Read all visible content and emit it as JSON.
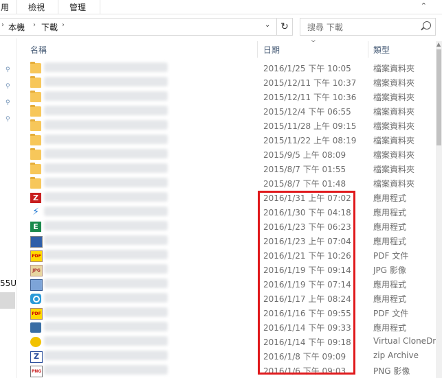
{
  "ribbon": {
    "tabs": [
      "用",
      "檢視",
      "管理"
    ]
  },
  "address": {
    "crumbs": [
      "本機",
      "下載"
    ]
  },
  "search": {
    "placeholder": "搜尋 下載"
  },
  "nav": {
    "fragment_label": "55U"
  },
  "columns": {
    "name": "名稱",
    "date": "日期",
    "type": "類型"
  },
  "rows": [
    {
      "icon": "folder-icon",
      "date": "2016/1/25 下午 10:05",
      "type": "檔案資料夾"
    },
    {
      "icon": "folder-icon",
      "date": "2015/12/11 下午 10:37",
      "type": "檔案資料夾"
    },
    {
      "icon": "folder-icon",
      "date": "2015/12/11 下午 10:36",
      "type": "檔案資料夾"
    },
    {
      "icon": "folder-icon",
      "date": "2015/12/4 下午 06:55",
      "type": "檔案資料夾"
    },
    {
      "icon": "folder-icon",
      "date": "2015/11/28 上午 09:15",
      "type": "檔案資料夾"
    },
    {
      "icon": "folder-icon",
      "date": "2015/11/22 上午 08:19",
      "type": "檔案資料夾"
    },
    {
      "icon": "folder-icon",
      "date": "2015/9/5 上午 08:09",
      "type": "檔案資料夾"
    },
    {
      "icon": "folder-icon",
      "date": "2015/8/7 下午 01:55",
      "type": "檔案資料夾"
    },
    {
      "icon": "folder-icon",
      "date": "2015/8/7 下午 01:48",
      "type": "檔案資料夾"
    },
    {
      "icon": "filezilla-icon",
      "date": "2016/1/31 上午 07:02",
      "type": "應用程式"
    },
    {
      "icon": "bolt-icon",
      "date": "2016/1/30 下午 04:18",
      "type": "應用程式"
    },
    {
      "icon": "e-app-icon",
      "date": "2016/1/23 下午 06:23",
      "type": "應用程式"
    },
    {
      "icon": "installer-icon",
      "date": "2016/1/23 上午 07:04",
      "type": "應用程式"
    },
    {
      "icon": "pdf-icon",
      "date": "2016/1/21 下午 10:26",
      "type": "PDF 文件"
    },
    {
      "icon": "jpg-icon",
      "date": "2016/1/19 下午 09:14",
      "type": "JPG 影像"
    },
    {
      "icon": "window-app-icon",
      "date": "2016/1/19 下午 07:14",
      "type": "應用程式"
    },
    {
      "icon": "ring-app-icon",
      "date": "2016/1/17 上午 08:24",
      "type": "應用程式"
    },
    {
      "icon": "pdf-icon",
      "date": "2016/1/16 下午 09:55",
      "type": "PDF 文件"
    },
    {
      "icon": "gear-app-icon",
      "date": "2016/1/14 下午 09:33",
      "type": "應用程式"
    },
    {
      "icon": "clonedrive-icon",
      "date": "2016/1/14 下午 09:18",
      "type": "Virtual CloneDrive"
    },
    {
      "icon": "zip-icon",
      "date": "2016/1/8 下午 09:09",
      "type": "zip Archive"
    },
    {
      "icon": "png-icon",
      "date": "2016/1/6 下午 09:03",
      "type": "PNG 影像"
    }
  ],
  "colors": {
    "highlight": "#e0191c",
    "folder": "#f7c75a",
    "header_text": "#4c607a"
  }
}
